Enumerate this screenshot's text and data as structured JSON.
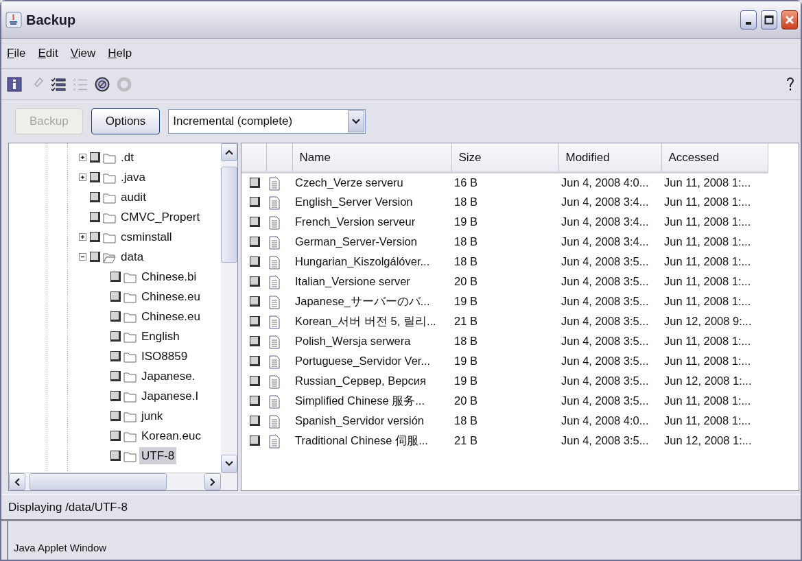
{
  "window": {
    "title": "Backup"
  },
  "menu": [
    "File",
    "Edit",
    "View",
    "Help"
  ],
  "toolbar": {
    "buttons": [
      {
        "kind": "info",
        "disabled": false
      },
      {
        "kind": "clean",
        "disabled": true
      },
      {
        "kind": "checklist",
        "disabled": false
      },
      {
        "kind": "uncheck",
        "disabled": true
      },
      {
        "kind": "stop",
        "disabled": false
      },
      {
        "kind": "ring",
        "disabled": true
      }
    ]
  },
  "actions": {
    "backup": {
      "label": "Backup",
      "disabled": true
    },
    "options": {
      "label": "Options",
      "disabled": false
    },
    "mode": {
      "value": "Incremental (complete)"
    }
  },
  "tree": [
    {
      "label": ".dt",
      "expanded": false,
      "checked": false,
      "selected": false
    },
    {
      "label": ".java",
      "expanded": false,
      "checked": false,
      "selected": false
    },
    {
      "label": "audit",
      "checked": false,
      "selected": false
    },
    {
      "label": "CMVC_Propert",
      "checked": false,
      "selected": false
    },
    {
      "label": "csminstall",
      "expanded": false,
      "checked": false,
      "selected": false
    },
    {
      "label": "data",
      "expanded": true,
      "checked": false,
      "selected": false,
      "children": [
        {
          "label": "Chinese.bi",
          "checked": false,
          "selected": false
        },
        {
          "label": "Chinese.eu",
          "checked": false,
          "selected": false
        },
        {
          "label": "Chinese.eu",
          "checked": false,
          "selected": false
        },
        {
          "label": "English",
          "checked": false,
          "selected": false
        },
        {
          "label": "ISO8859",
          "checked": false,
          "selected": false
        },
        {
          "label": "Japanese.",
          "checked": false,
          "selected": false
        },
        {
          "label": "Japanese.I",
          "checked": false,
          "selected": false
        },
        {
          "label": "junk",
          "checked": false,
          "selected": false
        },
        {
          "label": "Korean.euc",
          "checked": false,
          "selected": false
        },
        {
          "label": "UTF-8",
          "checked": false,
          "selected": true
        }
      ]
    }
  ],
  "table": {
    "columns": [
      "Name",
      "Size",
      "Modified",
      "Accessed"
    ],
    "rows": [
      {
        "checked": false,
        "name": "Czech_Verze serveru",
        "size": "16 B",
        "modified": "Jun 4, 2008 4:0...",
        "accessed": "Jun 11, 2008 1:..."
      },
      {
        "checked": false,
        "name": "English_Server Version",
        "size": "18 B",
        "modified": "Jun 4, 2008 3:4...",
        "accessed": "Jun 11, 2008 1:..."
      },
      {
        "checked": false,
        "name": "French_Version serveur",
        "size": "19 B",
        "modified": "Jun 4, 2008 3:4...",
        "accessed": "Jun 11, 2008 1:..."
      },
      {
        "checked": false,
        "name": "German_Server-Version",
        "size": "18 B",
        "modified": "Jun 4, 2008 3:4...",
        "accessed": "Jun 11, 2008 1:..."
      },
      {
        "checked": false,
        "name": "Hungarian_Kiszolgálóver...",
        "size": "18 B",
        "modified": "Jun 4, 2008 3:5...",
        "accessed": "Jun 11, 2008 1:..."
      },
      {
        "checked": false,
        "name": "Italian_Versione server",
        "size": "20 B",
        "modified": "Jun 4, 2008 3:5...",
        "accessed": "Jun 11, 2008 1:..."
      },
      {
        "checked": false,
        "name": "Japanese_サーバーのバ...",
        "size": "19 B",
        "modified": "Jun 4, 2008 3:5...",
        "accessed": "Jun 11, 2008 1:..."
      },
      {
        "checked": false,
        "name": "Korean_서버 버전 5, 릴리...",
        "size": "21 B",
        "modified": "Jun 4, 2008 3:5...",
        "accessed": "Jun 12, 2008 9:..."
      },
      {
        "checked": false,
        "name": "Polish_Wersja serwera",
        "size": "18 B",
        "modified": "Jun 4, 2008 3:5...",
        "accessed": "Jun 11, 2008 1:..."
      },
      {
        "checked": false,
        "name": "Portuguese_Servidor Ver...",
        "size": "19 B",
        "modified": "Jun 4, 2008 3:5...",
        "accessed": "Jun 11, 2008 1:..."
      },
      {
        "checked": false,
        "name": "Russian_Сервер, Версия",
        "size": "19 B",
        "modified": "Jun 4, 2008 3:5...",
        "accessed": "Jun 12, 2008 1:..."
      },
      {
        "checked": false,
        "name": "Simplified Chinese 服务...",
        "size": "20 B",
        "modified": "Jun 4, 2008 3:5...",
        "accessed": "Jun 11, 2008 1:..."
      },
      {
        "checked": false,
        "name": "Spanish_Servidor versión",
        "size": "18 B",
        "modified": "Jun 4, 2008 4:0...",
        "accessed": "Jun 11, 2008 1:..."
      },
      {
        "checked": false,
        "name": "Traditional Chinese 伺服...",
        "size": "21 B",
        "modified": "Jun 4, 2008 3:5...",
        "accessed": "Jun 12, 2008 1:..."
      }
    ]
  },
  "status_bar": "Displaying /data/UTF-8",
  "applet_bar": "Java Applet Window"
}
